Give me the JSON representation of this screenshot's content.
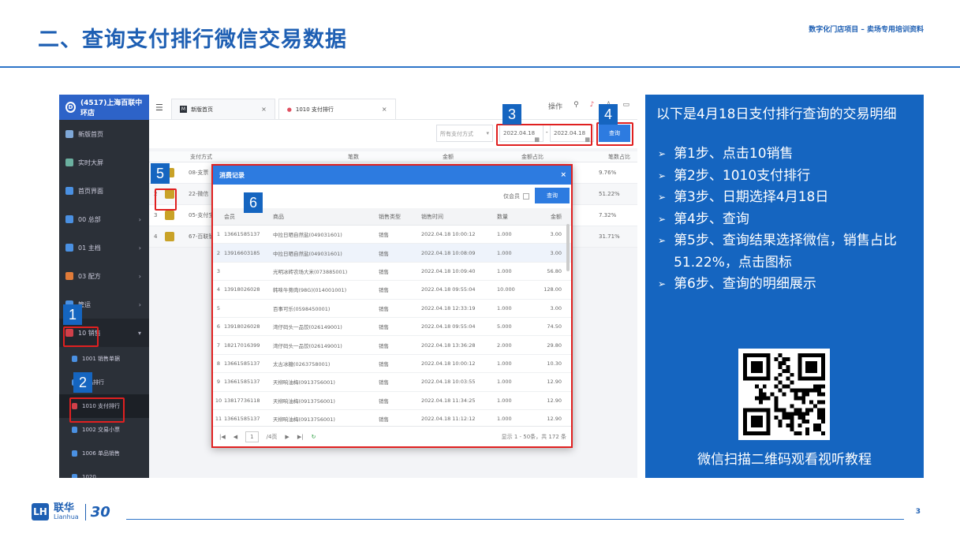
{
  "header": {
    "title": "二、查询支付排行微信交易数据",
    "tag": "数字化门店项目 – 卖场专用培训资料"
  },
  "app": {
    "store": "(4517)上海百联中环店",
    "menu": [
      {
        "label": "新版首页",
        "color": "#7fa8d8"
      },
      {
        "label": "实时大屏",
        "color": "#6bb0a0"
      },
      {
        "label": "首页界面",
        "color": "#4a90e2"
      },
      {
        "label": "00 总部",
        "color": "#4a90e2"
      },
      {
        "label": "01 主档",
        "color": "#4a90e2"
      },
      {
        "label": "03 配方",
        "color": "#e07b39"
      },
      {
        "label": "管运",
        "color": "#4a90e2"
      },
      {
        "label": "10 销售",
        "color": "#d0404a"
      }
    ],
    "submenu": [
      {
        "label": "1001 销售单据"
      },
      {
        "label": "单品排行"
      },
      {
        "label": "1010 支付排行"
      },
      {
        "label": "1002 交易小票"
      },
      {
        "label": "1006 单品销售"
      },
      {
        "label": "1020 ..."
      }
    ],
    "tabs": [
      {
        "label": "新版首页"
      },
      {
        "label": "1010 支付排行"
      }
    ],
    "top_op": "操作",
    "filter": {
      "method_placeholder": "所有支付方式",
      "date_from": "2022.04.18",
      "date_to": "2022.04.18",
      "query": "查询"
    },
    "table": {
      "headers": [
        "支付方式",
        "笔数",
        "金额",
        "金额占比",
        "笔数占比"
      ],
      "rows": [
        {
          "idx": "1",
          "method": "08-支票",
          "ratio": "9.76%"
        },
        {
          "idx": "2",
          "method": "22-微信",
          "ratio": "51.22%"
        },
        {
          "idx": "3",
          "method": "05-支付宝",
          "ratio": "7.32%"
        },
        {
          "idx": "4",
          "method": "67-百联智慧",
          "ratio": "31.71%"
        }
      ]
    }
  },
  "modal": {
    "title": "消费记录",
    "member_only": "仅会员",
    "query": "查询",
    "headers": [
      "会员",
      "商品",
      "销售类型",
      "销售时间",
      "数量",
      "金额"
    ],
    "rows": [
      {
        "n": "1",
        "m": "13661585137",
        "p": "中拉日晒自然盐(049031601)",
        "t": "销售",
        "time": "2022.04.18 10:00:12",
        "q": "1.000",
        "a": "3.00"
      },
      {
        "n": "2",
        "m": "13916603185",
        "p": "中拉日晒自然盐(049031601)",
        "t": "销售",
        "time": "2022.04.18 10:08:09",
        "q": "1.000",
        "a": "3.00"
      },
      {
        "n": "3",
        "m": "",
        "p": "光明冰砖农场大米(073885001)",
        "t": "销售",
        "time": "2022.04.18 10:09:40",
        "q": "1.000",
        "a": "56.80"
      },
      {
        "n": "4",
        "m": "13918026028",
        "p": "韩味牛蒡肉(98G)(014001001)",
        "t": "销售",
        "time": "2022.04.18 09:55:04",
        "q": "10.000",
        "a": "128.00"
      },
      {
        "n": "5",
        "m": "",
        "p": "百事可乐(0598450001)",
        "t": "销售",
        "time": "2022.04.18 12:33:19",
        "q": "1.000",
        "a": "3.00"
      },
      {
        "n": "6",
        "m": "13918026028",
        "p": "湾仔码头一品饺(026149001)",
        "t": "销售",
        "time": "2022.04.18 09:55:04",
        "q": "5.000",
        "a": "74.50"
      },
      {
        "n": "7",
        "m": "18217016399",
        "p": "湾仔码头一品饺(026149001)",
        "t": "销售",
        "time": "2022.04.18 13:36:28",
        "q": "2.000",
        "a": "29.80"
      },
      {
        "n": "8",
        "m": "13661585137",
        "p": "太古冰糖(0263758001)",
        "t": "销售",
        "time": "2022.04.18 10:00:12",
        "q": "1.000",
        "a": "10.30"
      },
      {
        "n": "9",
        "m": "13661585137",
        "p": "天柳响油梅(0913756001)",
        "t": "销售",
        "time": "2022.04.18 10:03:55",
        "q": "1.000",
        "a": "12.90"
      },
      {
        "n": "10",
        "m": "13817736118",
        "p": "天柳响油梅(0913756001)",
        "t": "销售",
        "time": "2022.04.18 11:34:25",
        "q": "1.000",
        "a": "12.90"
      },
      {
        "n": "11",
        "m": "13661585137",
        "p": "天柳响油梅(0913756001)",
        "t": "销售",
        "time": "2022.04.18 11:12:12",
        "q": "1.000",
        "a": "12.90"
      }
    ],
    "page_current": "1",
    "page_total": "/4页",
    "info": "显示 1 - 50条，共 172 条"
  },
  "panel": {
    "intro": "以下是4月18日支付排行查询的交易明细",
    "steps": [
      "第1步、点击10销售",
      "第2步、1010支付排行",
      "第3步、日期选择4月18日",
      "第4步、查询",
      "第5步、查询结果选择微信，销售占比51.22%，点击图标",
      "第6步、查询的明细展示"
    ],
    "qr_caption": "微信扫描二维码观看视听教程"
  },
  "markers": [
    "1",
    "2",
    "3",
    "4",
    "5",
    "6"
  ],
  "footer": {
    "brand_cn": "联华",
    "brand_en": "Lianhua",
    "anniv": "30",
    "page": "3"
  }
}
